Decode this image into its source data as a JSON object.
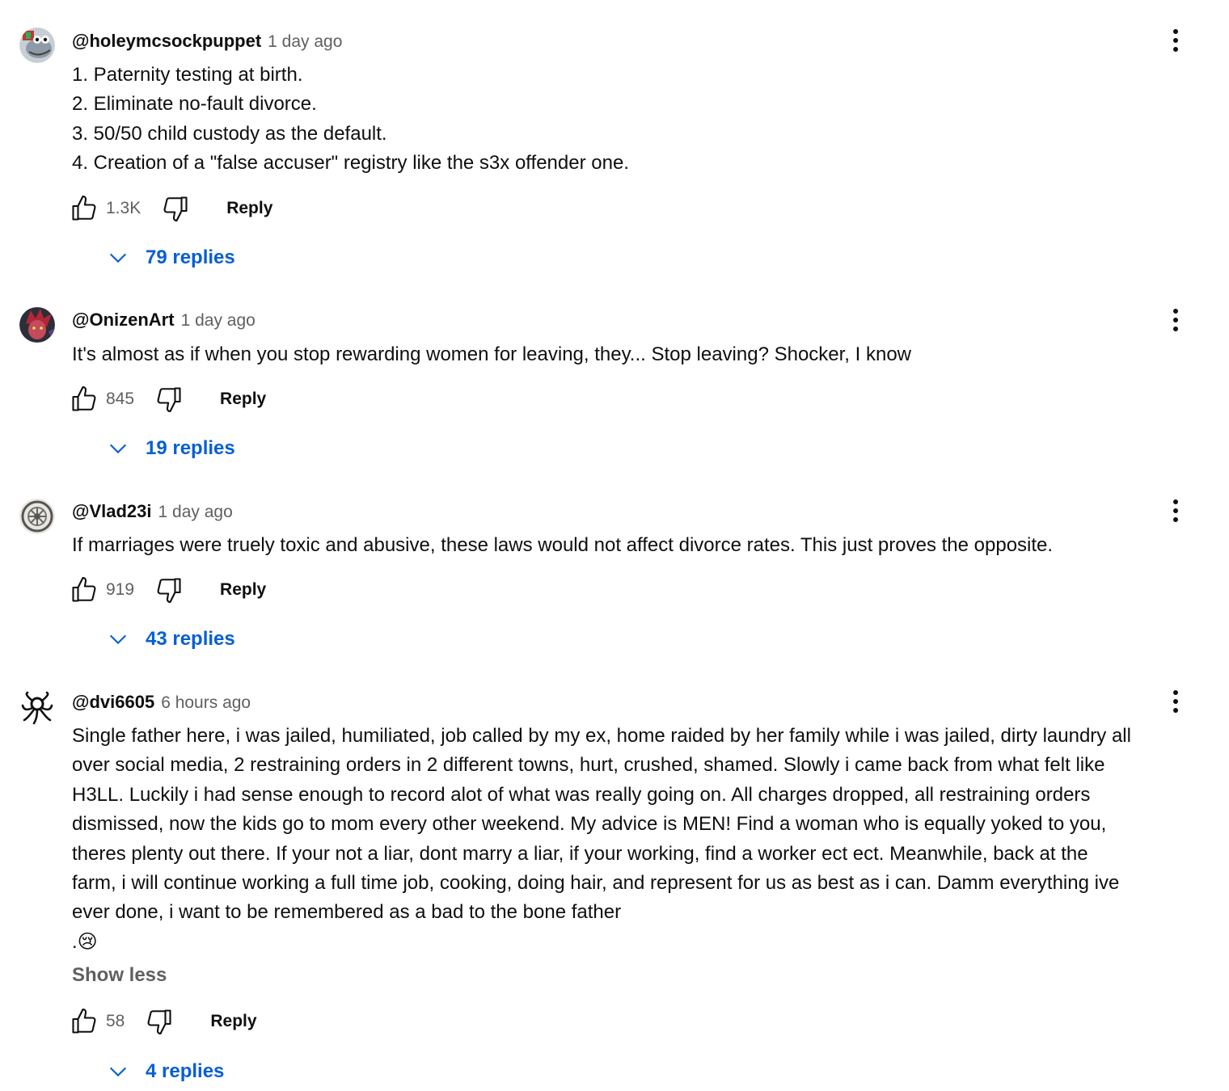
{
  "comments": [
    {
      "author": "@holeymcsockpuppet",
      "time": "1 day ago",
      "avatar_icon": "cartoon-avatar",
      "lines": [
        "1. Paternity testing at birth.",
        "2. Eliminate no-fault divorce.",
        "3. 50/50 child custody as the default.",
        "4. Creation of a \"false accuser\" registry like the s3x offender one."
      ],
      "likes": "1.3K",
      "reply_label": "Reply",
      "replies_label": "79 replies"
    },
    {
      "author": "@OnizenArt",
      "time": "1 day ago",
      "avatar_icon": "character-avatar",
      "lines": [
        "It's almost as if when you stop rewarding women for leaving, they... Stop leaving? Shocker, I know"
      ],
      "likes": "845",
      "reply_label": "Reply",
      "replies_label": "19 replies"
    },
    {
      "author": "@Vlad23i",
      "time": "1 day ago",
      "avatar_icon": "wheel-avatar",
      "lines": [
        "If marriages were truely toxic and abusive, these laws would not affect divorce rates. This just proves the opposite."
      ],
      "likes": "919",
      "reply_label": "Reply",
      "replies_label": "43 replies"
    },
    {
      "author": "@dvi6605",
      "time": "6 hours ago",
      "avatar_icon": "octopus-avatar",
      "lines": [
        "Single father here, i was jailed, humiliated, job called by my ex, home raided by her family while i was jailed, dirty laundry all",
        "over social media, 2 restraining orders in 2 different towns, hurt, crushed, shamed. Slowly i came back from what felt like",
        "H3LL. Luckily i had sense enough to record alot of what was really going on.  All charges dropped, all restraining orders",
        "dismissed, now the kids go to mom every other weekend.  My advice is MEN! Find a woman who is equally yoked to you,",
        "theres plenty out there.  If your not a liar, dont marry a liar, if your working, find a worker ect ect.  Meanwhile, back at the",
        "farm, i will continue working a full time job, cooking, doing hair, and represent for us as best as i can.  Damm everything ive",
        "ever done, i want to be remembered as a bad to the bone father",
        ".😢"
      ],
      "show_less": "Show less",
      "likes": "58",
      "reply_label": "Reply",
      "replies_label": "4 replies"
    }
  ],
  "colors": {
    "link_blue": "#065fd4",
    "text_primary": "#0f0f0f",
    "text_secondary": "#606060"
  }
}
